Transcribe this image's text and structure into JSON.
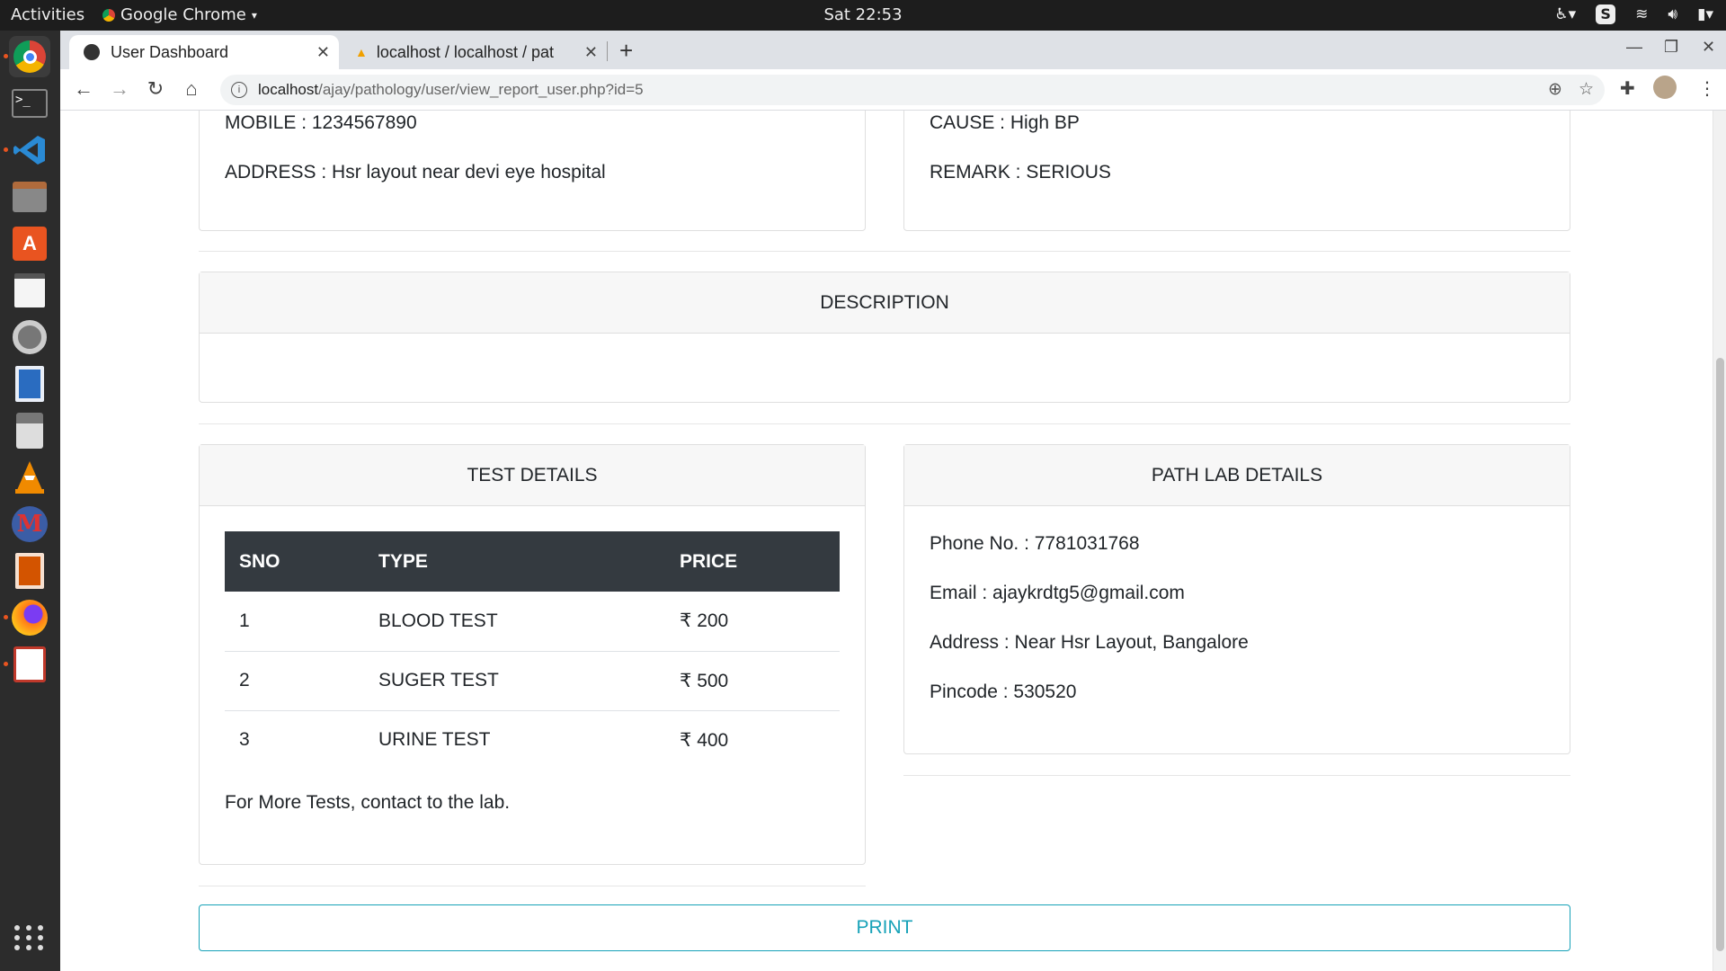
{
  "os": {
    "activities": "Activities",
    "app_menu": "Google Chrome",
    "clock": "Sat 22:53"
  },
  "browser": {
    "tabs": [
      {
        "title": "User Dashboard"
      },
      {
        "title": "localhost / localhost / pat"
      }
    ],
    "url_host": "localhost",
    "url_path": "/ajay/pathology/user/view_report_user.php?id=5"
  },
  "patient": {
    "mobile": "MOBILE : 1234567890",
    "address": "ADDRESS : Hsr layout near devi eye hospital",
    "cause": "CAUSE : High BP",
    "remark": "REMARK : SERIOUS"
  },
  "description": {
    "title": "DESCRIPTION",
    "text": ""
  },
  "tests": {
    "title": "TEST DETAILS",
    "columns": [
      "SNO",
      "TYPE",
      "PRICE"
    ],
    "rows": [
      [
        "1",
        "BLOOD TEST",
        "₹ 200"
      ],
      [
        "2",
        "SUGER TEST",
        "₹ 500"
      ],
      [
        "3",
        "URINE TEST",
        "₹ 400"
      ]
    ],
    "note": "For More Tests, contact to the lab."
  },
  "lab": {
    "title": "PATH LAB DETAILS",
    "phone": "Phone No. : 7781031768",
    "email": "Email : ajaykrdtg5@gmail.com",
    "address": "Address : Near Hsr Layout, Bangalore",
    "pincode": "Pincode : 530520"
  },
  "print_label": "PRINT",
  "colors": {
    "accent": "#17a2b8",
    "table_header": "#343a40",
    "ubuntu_orange": "#e95420"
  }
}
